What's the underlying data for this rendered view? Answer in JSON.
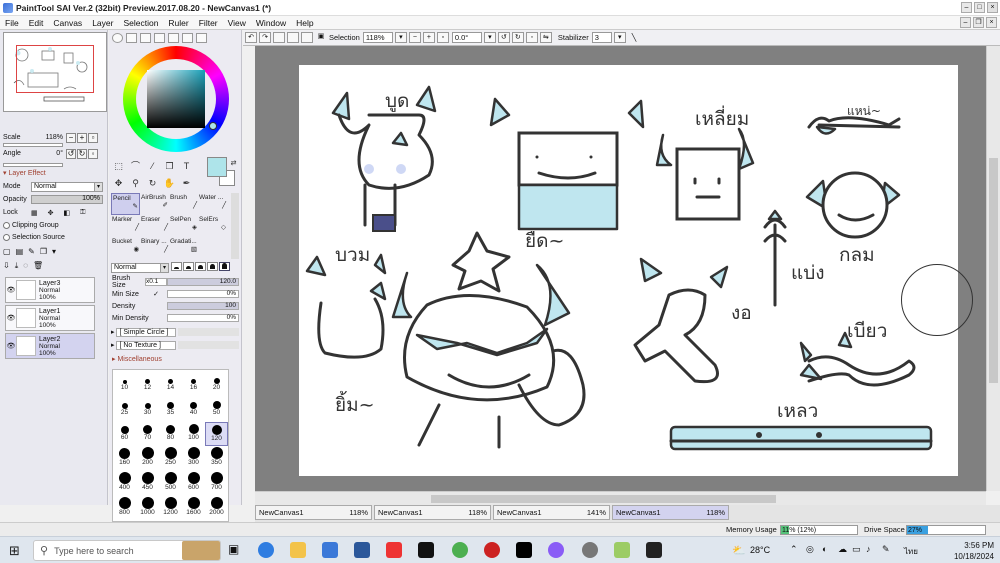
{
  "window": {
    "title": "PaintTool SAI Ver.2 (32bit) Preview.2017.08.20 - NewCanvas1 (*)"
  },
  "menu": [
    "File",
    "Edit",
    "Canvas",
    "Layer",
    "Selection",
    "Ruler",
    "Filter",
    "View",
    "Window",
    "Help"
  ],
  "navigator": {
    "scale_label": "Scale",
    "scale_value": "118%",
    "angle_label": "Angle",
    "angle_value": "0°"
  },
  "layer_effect": {
    "header": "Layer Effect",
    "mode_label": "Mode",
    "mode_value": "Normal",
    "opacity_label": "Opacity",
    "opacity_value": "100%",
    "lock_label": "Lock",
    "clipping": "Clipping Group",
    "selection_source": "Selection Source"
  },
  "layers": [
    {
      "name": "Layer3",
      "mode": "Normal",
      "opacity": "100%",
      "selected": false
    },
    {
      "name": "Layer1",
      "mode": "Normal",
      "opacity": "100%",
      "selected": false
    },
    {
      "name": "Layer2",
      "mode": "Normal",
      "opacity": "100%",
      "selected": true
    }
  ],
  "brushes": [
    {
      "label": "Pencil",
      "selected": true
    },
    {
      "label": "AirBrush"
    },
    {
      "label": "Brush"
    },
    {
      "label": "Water ..."
    },
    {
      "label": "Marker"
    },
    {
      "label": "Eraser"
    },
    {
      "label": "SelPen"
    },
    {
      "label": "SelErs"
    },
    {
      "label": "Bucket"
    },
    {
      "label": "Binary ..."
    },
    {
      "label": "Gradati..."
    }
  ],
  "brush_settings": {
    "blend_mode": "Normal",
    "size_label": "Brush Size",
    "size_mult": "x0.1",
    "size_value": "120.0",
    "minsize_label": "Min Size",
    "minsize_value": "0%",
    "density_label": "Density",
    "density_value": "100",
    "mindensity_label": "Min Density",
    "mindensity_value": "0%",
    "shape": "[ Simple Circle ]",
    "texture": "[ No Texture ]",
    "misc_header": "Miscellaneous"
  },
  "brush_sizes": [
    "10",
    "12",
    "14",
    "16",
    "20",
    "25",
    "30",
    "35",
    "40",
    "50",
    "60",
    "70",
    "80",
    "100",
    "120",
    "160",
    "200",
    "250",
    "300",
    "350",
    "400",
    "450",
    "500",
    "600",
    "700",
    "800",
    "1000",
    "1200",
    "1600",
    "2000"
  ],
  "selected_brush_size": "120",
  "canvas_toolbar": {
    "selection_label": "Selection",
    "zoom": "118%",
    "angle": "0.0°",
    "stabilizer_label": "Stabilizer",
    "stabilizer_value": "3"
  },
  "canvas_texts": [
    "บูด",
    "เหลี่ยม",
    "แหน่~",
    "ยืด~",
    "บวม",
    "กลม",
    "แบ่ง",
    "งอ",
    "เบียว",
    "ยิ้ม~",
    "เหลว"
  ],
  "doc_tabs": [
    {
      "name": "NewCanvas1",
      "zoom": "118%"
    },
    {
      "name": "NewCanvas1",
      "zoom": "118%"
    },
    {
      "name": "NewCanvas1",
      "zoom": "141%"
    },
    {
      "name": "NewCanvas1",
      "zoom": "118%",
      "active": true
    }
  ],
  "status": {
    "memory_label": "Memory Usage",
    "memory_text": "11% (12%)",
    "memory_level": 0.11,
    "drive_label": "Drive Space",
    "drive_text": "27%",
    "drive_level": 0.27
  },
  "taskbar": {
    "search_placeholder": "Type here to search",
    "temperature": "28°C",
    "language": "ไทย",
    "time": "3:56 PM",
    "date": "10/18/2024"
  }
}
